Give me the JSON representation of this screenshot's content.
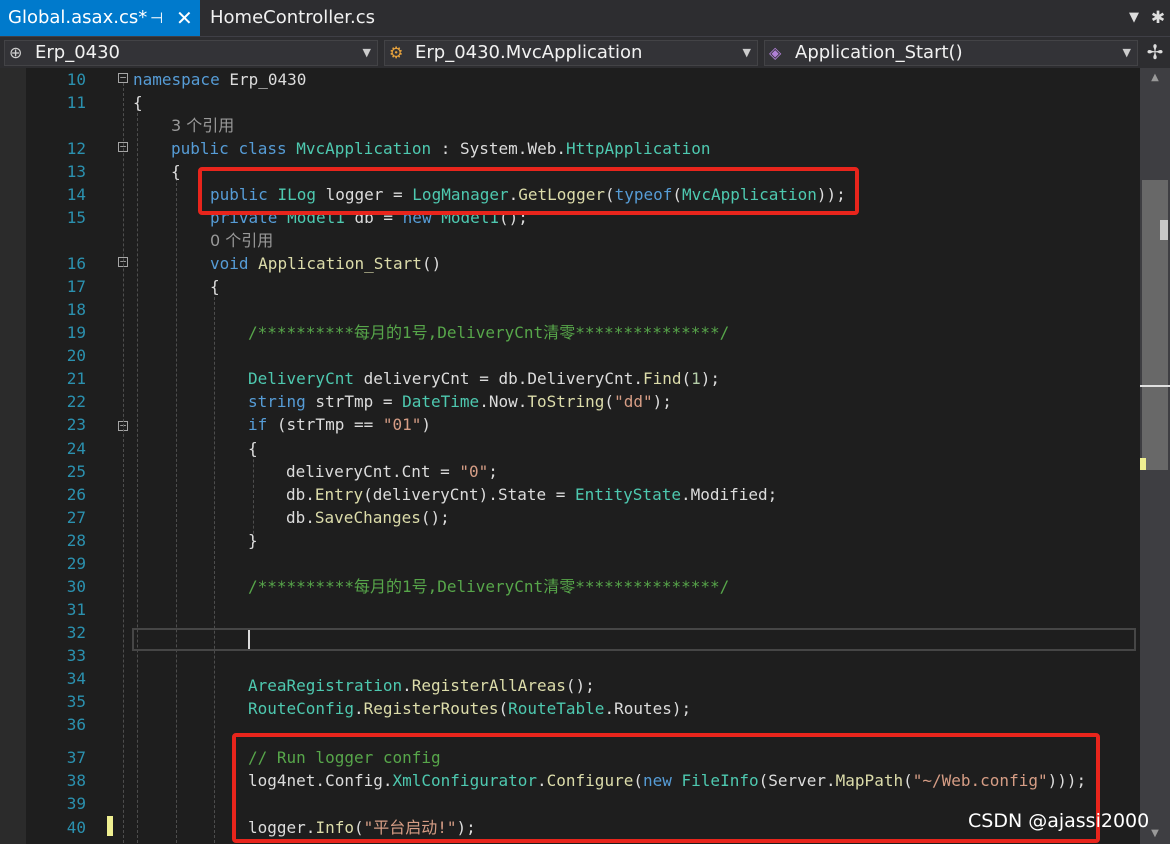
{
  "tabs": {
    "active": {
      "label": "Global.asax.cs*",
      "pin": "⊣",
      "close": "✕"
    },
    "inactive": {
      "label": "HomeController.cs"
    },
    "overflow_icon": "chevron-down-icon",
    "settings_icon": "settings-icon"
  },
  "navbar": {
    "project": "Erp_0430",
    "type": "Erp_0430.MvcApplication",
    "member": "Application_Start()"
  },
  "line_numbers": [
    "10",
    "11",
    "12",
    "13",
    "14",
    "15",
    "16",
    "17",
    "18",
    "19",
    "20",
    "21",
    "22",
    "23",
    "24",
    "25",
    "26",
    "27",
    "28",
    "29",
    "30",
    "31",
    "32",
    "33",
    "34",
    "35",
    "36",
    "37",
    "38",
    "39",
    "40"
  ],
  "ref_hints": [
    "3 个引用",
    "0 个引用"
  ],
  "code": {
    "l10": {
      "kw": "namespace",
      "name": " Erp_0430"
    },
    "l11": "{",
    "l12": {
      "kw1": "public",
      "kw2": "class",
      "cls": "MvcApplication",
      "sep": " : System.Web.",
      "base": "HttpApplication"
    },
    "l13": "{",
    "l14": {
      "kw": "public",
      "type": "ILog",
      "rest": " logger = ",
      "cls": "LogManager",
      "dot": ".",
      "fn": "GetLogger",
      "p1": "(",
      "kw2": "typeof",
      "p2": "(",
      "arg": "MvcApplication",
      "p3": "));"
    },
    "l15": {
      "kw": "private",
      "type": "Model1",
      "rest": " db = ",
      "kw2": "new",
      "type2": "Model1",
      "end": "();"
    },
    "l16": {
      "kw": "void",
      "fn": "Application_Start",
      "end": "()"
    },
    "l17": "{",
    "l19": "/**********每月的1号,DeliveryCnt清零***************/",
    "l21": {
      "type": "DeliveryCnt",
      "rest": " deliveryCnt = db.",
      "prop": "DeliveryCnt",
      "dot": ".",
      "fn": "Find",
      "p": "(",
      "num": "1",
      "end": ");"
    },
    "l22": {
      "kw": "string",
      "rest": " strTmp = ",
      "type": "DateTime",
      "mid": ".Now.",
      "fn": "ToString",
      "p": "(",
      "str": "\"dd\"",
      "end": ");"
    },
    "l23": {
      "kw": "if",
      "rest": " (strTmp == ",
      "str": "\"01\"",
      "end": ")"
    },
    "l24": "{",
    "l25": {
      "pre": "deliveryCnt.Cnt = ",
      "str": "\"0\"",
      "end": ";"
    },
    "l26": {
      "pre": "db.",
      "fn": "Entry",
      "mid": "(deliveryCnt).State = ",
      "type": "EntityState",
      "end": ".Modified;"
    },
    "l27": {
      "pre": "db.",
      "fn": "SaveChanges",
      "end": "();"
    },
    "l28": "}",
    "l30": "/**********每月的1号,DeliveryCnt清零***************/",
    "l34": {
      "type": "AreaRegistration",
      "dot": ".",
      "fn": "RegisterAllAreas",
      "end": "();"
    },
    "l35": {
      "type": "RouteConfig",
      "dot": ".",
      "fn": "RegisterRoutes",
      "p": "(",
      "type2": "RouteTable",
      "end": ".Routes);"
    },
    "l37": "// Run logger config",
    "l38": {
      "pre": "log4net.Config.",
      "type": "XmlConfigurator",
      "dot": ".",
      "fn": "Configure",
      "p": "(",
      "kw": "new",
      "type2": "FileInfo",
      "mid": "(Server.",
      "fn2": "MapPath",
      "p2": "(",
      "str": "\"~/Web.config\"",
      "end": ")));"
    },
    "l40": {
      "pre": "logger.",
      "fn": "Info",
      "p": "(",
      "str": "\"平台启动!\"",
      "end": ");"
    }
  },
  "watermark": "CSDN @ajassi2000",
  "colors": {
    "accent": "#007acc",
    "highlight_box": "#e8251c",
    "background": "#1e1e1e"
  }
}
